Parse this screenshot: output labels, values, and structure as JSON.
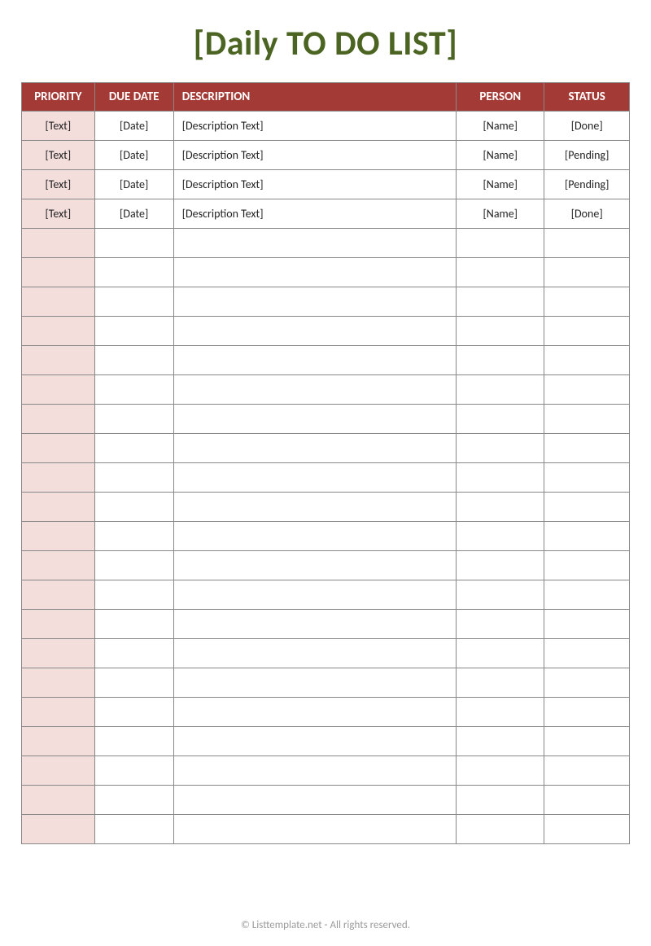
{
  "title": "[Daily TO DO LIST]",
  "columns": {
    "priority": "PRIORITY",
    "due": "DUE DATE",
    "desc": "DESCRIPTION",
    "person": "PERSON",
    "status": "STATUS"
  },
  "rows": [
    {
      "priority": "[Text]",
      "due": "[Date]",
      "desc": "[Description Text]",
      "person": "[Name]",
      "status": "[Done]"
    },
    {
      "priority": "[Text]",
      "due": "[Date]",
      "desc": "[Description Text]",
      "person": "[Name]",
      "status": "[Pending]"
    },
    {
      "priority": "[Text]",
      "due": "[Date]",
      "desc": "[Description Text]",
      "person": "[Name]",
      "status": "[Pending]"
    },
    {
      "priority": "[Text]",
      "due": "[Date]",
      "desc": "[Description Text]",
      "person": "[Name]",
      "status": "[Done]"
    },
    {
      "priority": "",
      "due": "",
      "desc": "",
      "person": "",
      "status": ""
    },
    {
      "priority": "",
      "due": "",
      "desc": "",
      "person": "",
      "status": ""
    },
    {
      "priority": "",
      "due": "",
      "desc": "",
      "person": "",
      "status": ""
    },
    {
      "priority": "",
      "due": "",
      "desc": "",
      "person": "",
      "status": ""
    },
    {
      "priority": "",
      "due": "",
      "desc": "",
      "person": "",
      "status": ""
    },
    {
      "priority": "",
      "due": "",
      "desc": "",
      "person": "",
      "status": ""
    },
    {
      "priority": "",
      "due": "",
      "desc": "",
      "person": "",
      "status": ""
    },
    {
      "priority": "",
      "due": "",
      "desc": "",
      "person": "",
      "status": ""
    },
    {
      "priority": "",
      "due": "",
      "desc": "",
      "person": "",
      "status": ""
    },
    {
      "priority": "",
      "due": "",
      "desc": "",
      "person": "",
      "status": ""
    },
    {
      "priority": "",
      "due": "",
      "desc": "",
      "person": "",
      "status": ""
    },
    {
      "priority": "",
      "due": "",
      "desc": "",
      "person": "",
      "status": ""
    },
    {
      "priority": "",
      "due": "",
      "desc": "",
      "person": "",
      "status": ""
    },
    {
      "priority": "",
      "due": "",
      "desc": "",
      "person": "",
      "status": ""
    },
    {
      "priority": "",
      "due": "",
      "desc": "",
      "person": "",
      "status": ""
    },
    {
      "priority": "",
      "due": "",
      "desc": "",
      "person": "",
      "status": ""
    },
    {
      "priority": "",
      "due": "",
      "desc": "",
      "person": "",
      "status": ""
    },
    {
      "priority": "",
      "due": "",
      "desc": "",
      "person": "",
      "status": ""
    },
    {
      "priority": "",
      "due": "",
      "desc": "",
      "person": "",
      "status": ""
    },
    {
      "priority": "",
      "due": "",
      "desc": "",
      "person": "",
      "status": ""
    },
    {
      "priority": "",
      "due": "",
      "desc": "",
      "person": "",
      "status": ""
    }
  ],
  "footer": "© Listtemplate.net - All rights reserved."
}
